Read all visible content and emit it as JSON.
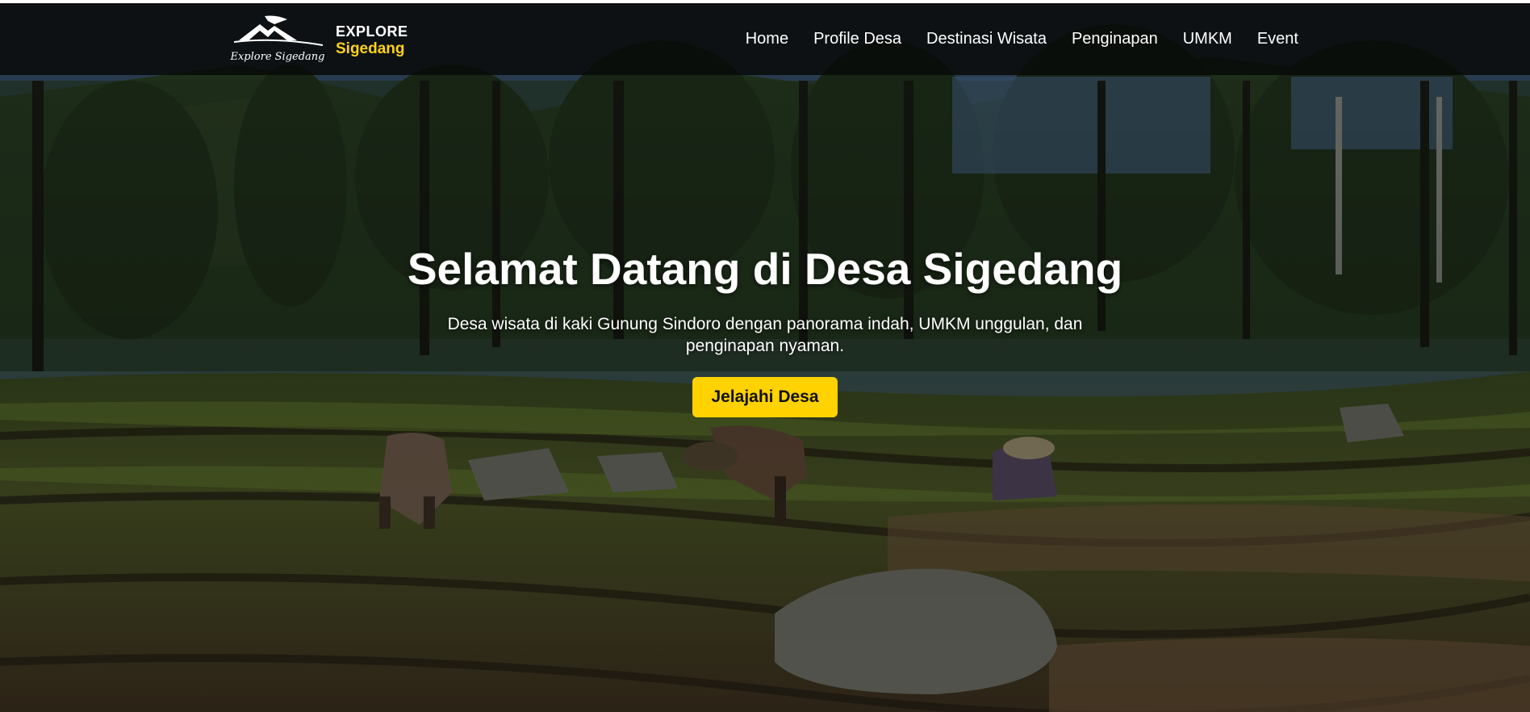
{
  "brand": {
    "logo_script": "Explore Sigedang",
    "line1": "EXPLORE",
    "line2": "Sigedang"
  },
  "nav": {
    "items": [
      {
        "label": "Home"
      },
      {
        "label": "Profile Desa"
      },
      {
        "label": "Destinasi Wisata"
      },
      {
        "label": "Penginapan"
      },
      {
        "label": "UMKM"
      },
      {
        "label": "Event"
      }
    ]
  },
  "hero": {
    "title": "Selamat Datang di Desa Sigedang",
    "subtitle": "Desa wisata di kaki Gunung Sindoro dengan panorama indah, UMKM unggulan, dan penginapan nyaman.",
    "cta_label": "Jelajahi Desa"
  },
  "colors": {
    "accent": "#ffd200",
    "brand_yellow": "#ffd21a",
    "navbar": "#080908",
    "text": "#ffffff"
  },
  "icons": [
    "mountain-logo-icon"
  ]
}
